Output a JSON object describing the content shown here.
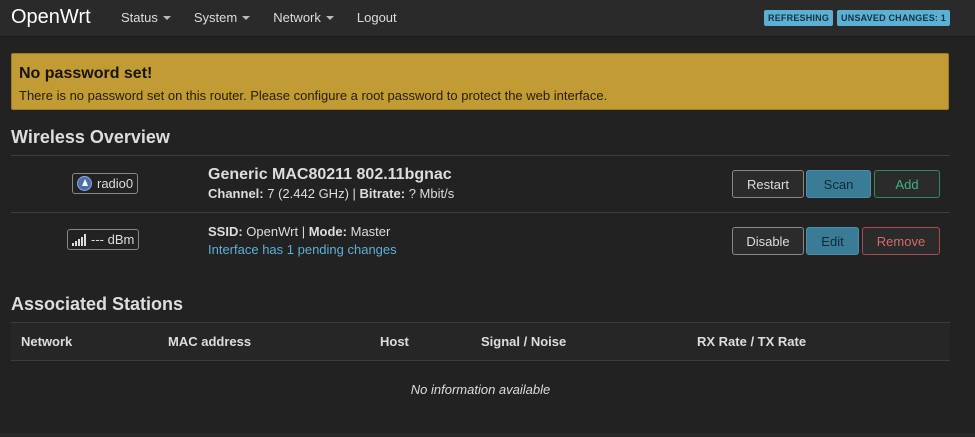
{
  "header": {
    "brand": "OpenWrt",
    "menu": [
      {
        "label": "Status"
      },
      {
        "label": "System"
      },
      {
        "label": "Network"
      },
      {
        "label": "Logout"
      }
    ],
    "badges": {
      "refreshing": "REFRESHING",
      "unsaved": "UNSAVED CHANGES: 1"
    }
  },
  "alert": {
    "title": "No password set!",
    "message": "There is no password set on this router. Please configure a root password to protect the web interface."
  },
  "wireless": {
    "title": "Wireless Overview",
    "device": {
      "tag": "radio0",
      "name": "Generic MAC80211 802.11bgnac",
      "channel_label": "Channel:",
      "channel_value": "7 (2.442 GHz)",
      "bitrate_label": "Bitrate:",
      "bitrate_value": "? Mbit/s",
      "buttons": {
        "restart": "Restart",
        "scan": "Scan",
        "add": "Add"
      }
    },
    "interface": {
      "signal": "--- dBm",
      "ssid_label": "SSID:",
      "ssid_value": "OpenWrt",
      "mode_label": "Mode:",
      "mode_value": "Master",
      "pending": "Interface has 1 pending changes",
      "buttons": {
        "disable": "Disable",
        "edit": "Edit",
        "remove": "Remove"
      }
    }
  },
  "stations": {
    "title": "Associated Stations",
    "columns": [
      "Network",
      "MAC address",
      "Host",
      "Signal / Noise",
      "RX Rate / TX Rate"
    ],
    "empty": "No information available"
  },
  "icons": {
    "radio": "radio-tower-icon",
    "signal": "signal-bars-icon",
    "caret": "caret-down-icon"
  }
}
